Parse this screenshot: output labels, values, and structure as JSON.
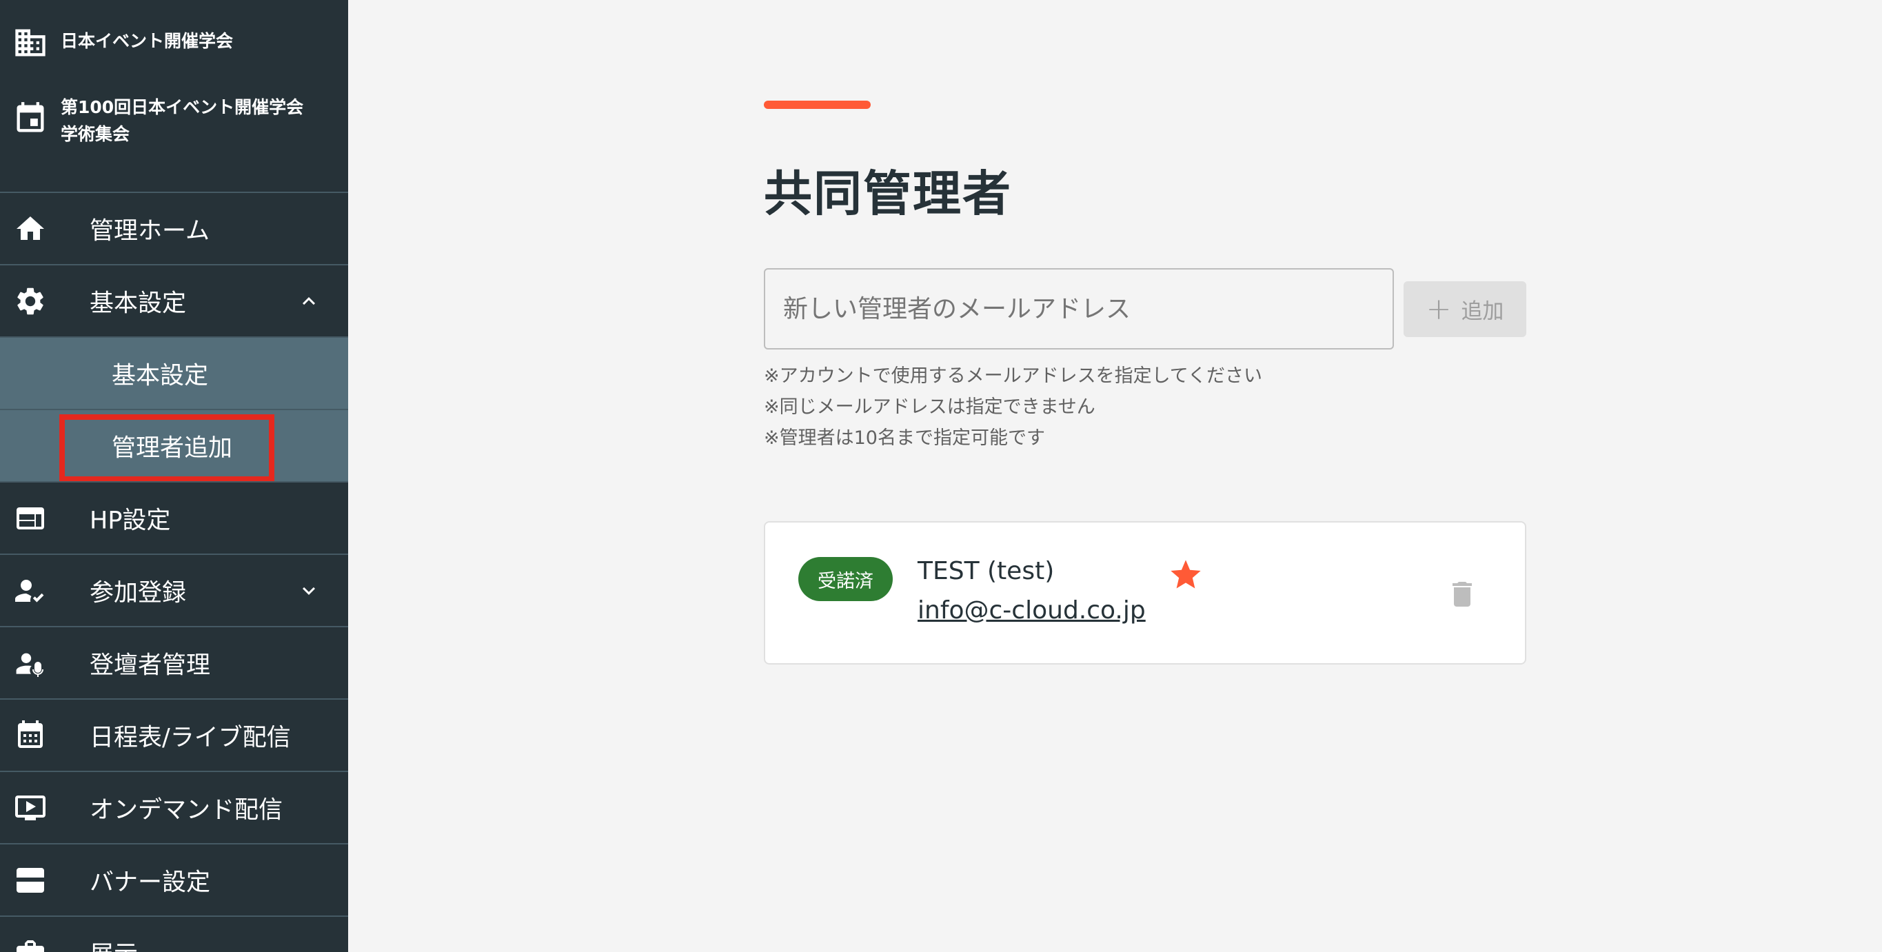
{
  "sidebar": {
    "organization": {
      "name": "日本イベント開催学会",
      "icon": "building-icon"
    },
    "event": {
      "line1": "第100回日本イベント開催学会",
      "line2": "学術集会",
      "icon": "calendar-icon"
    },
    "items": [
      {
        "label": "管理ホーム",
        "icon": "home-icon"
      },
      {
        "label": "基本設定",
        "icon": "gear-icon",
        "expanded": true
      },
      {
        "label": "基本設定",
        "sub": true
      },
      {
        "label": "管理者追加",
        "sub": true,
        "active": true
      },
      {
        "label": "HP設定",
        "icon": "web-layout-icon"
      },
      {
        "label": "参加登録",
        "icon": "person-check-icon",
        "expanded": false
      },
      {
        "label": "登壇者管理",
        "icon": "speaker-icon"
      },
      {
        "label": "日程表/ライブ配信",
        "icon": "calendar-grid-icon"
      },
      {
        "label": "オンデマンド配信",
        "icon": "play-screen-icon"
      },
      {
        "label": "バナー設定",
        "icon": "banner-icon"
      },
      {
        "label": "展示",
        "icon": "briefcase-icon"
      }
    ]
  },
  "main": {
    "title": "共同管理者",
    "input": {
      "placeholder": "新しい管理者のメールアドレス",
      "value": ""
    },
    "add_button": {
      "label": "追加",
      "icon": "plus-icon"
    },
    "notes": [
      "※アカウントで使用するメールアドレスを指定してください",
      "※同じメールアドレスは指定できません",
      "※管理者は10名まで指定可能です"
    ],
    "admins": [
      {
        "status": "受諾済",
        "name": "TEST (test)",
        "email": "info@c-cloud.co.jp",
        "owner": true
      }
    ]
  },
  "colors": {
    "sidebar_bg": "#263238",
    "sidebar_sub_bg": "#546e7a",
    "accent": "#ff5a36",
    "badge_green": "#2e7d32",
    "highlight_red": "#e5281e"
  }
}
